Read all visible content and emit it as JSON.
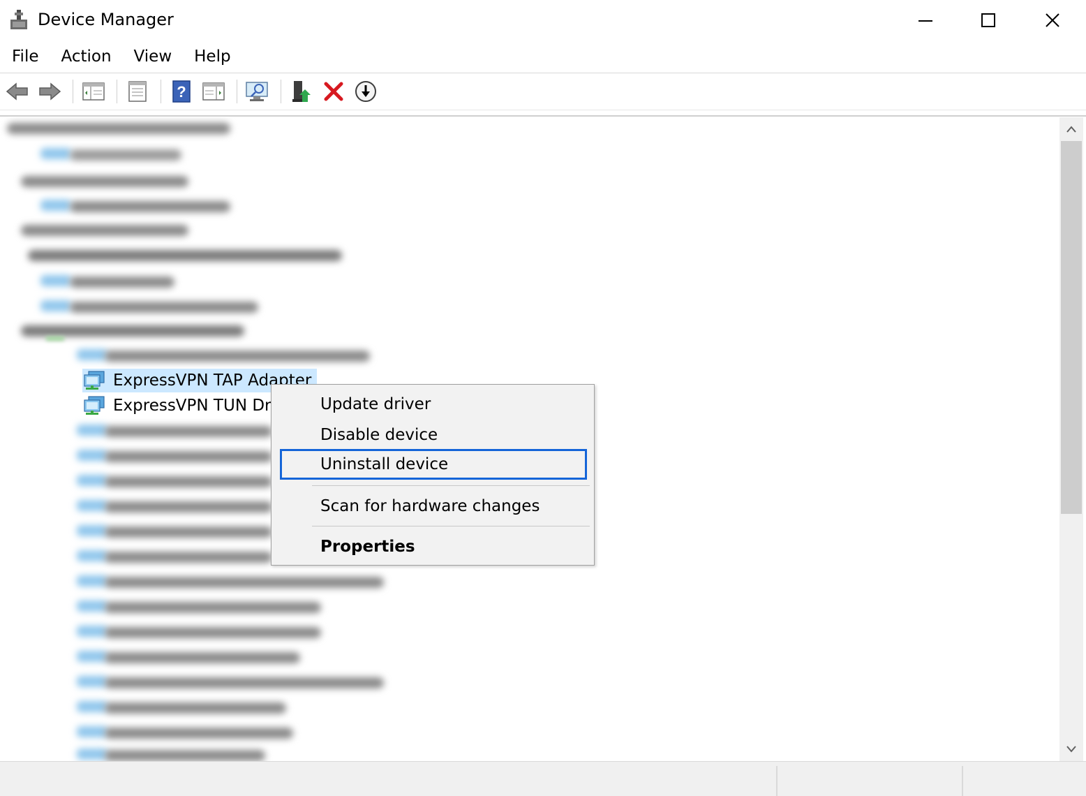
{
  "window": {
    "title": "Device Manager",
    "icons": {
      "app": "device-manager-icon",
      "minimize": "minimize-icon",
      "maximize": "maximize-icon",
      "close": "close-icon"
    }
  },
  "menubar": {
    "items": [
      "File",
      "Action",
      "View",
      "Help"
    ]
  },
  "toolbar": {
    "buttons": [
      "back-icon",
      "forward-icon",
      "show-hide-console-tree-icon",
      "properties-icon",
      "help-icon",
      "show-hide-action-pane-icon",
      "scan-hardware-icon",
      "update-driver-icon",
      "uninstall-icon",
      "enable-disable-icon"
    ]
  },
  "tree": {
    "devices": [
      {
        "label": "ExpressVPN TAP Adapter",
        "selected": true
      },
      {
        "label": "ExpressVPN TUN Driv"
      }
    ]
  },
  "context_menu": {
    "items": [
      {
        "label": "Update driver"
      },
      {
        "label": "Disable device"
      },
      {
        "label": "Uninstall device",
        "focused": true
      },
      {
        "label": "Scan for hardware changes"
      },
      {
        "label": "Properties",
        "bold": true
      }
    ]
  },
  "colors": {
    "selection": "#cce8ff",
    "focus_border": "#1565d8",
    "menu_bg": "#f2f2f2",
    "delete_red": "#d71920"
  }
}
